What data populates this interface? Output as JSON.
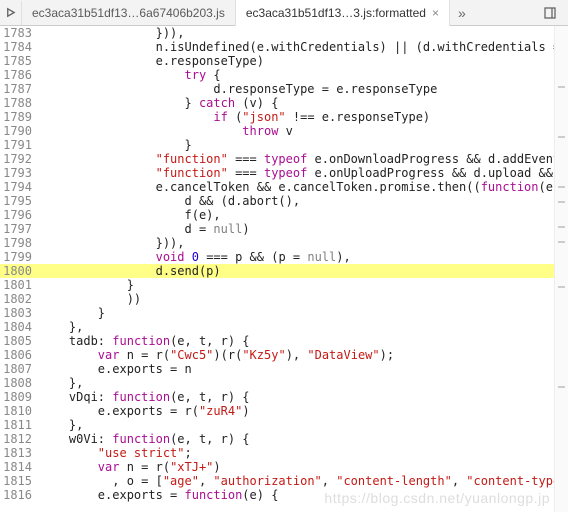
{
  "tabs": {
    "inactive_label": "ec3aca31b51df13…6a67406b203.js",
    "active_label": "ec3aca31b51df13…3.js:formatted",
    "close_glyph": "×",
    "more_glyph": "»"
  },
  "watermark": "https://blog.csdn.net/yuanlongp.jp",
  "gutter_ticks": [
    60,
    110,
    160,
    175,
    200,
    215,
    260,
    360
  ],
  "lines": [
    {
      "n": 1783,
      "indent": 16,
      "tokens": [
        "})),"
      ]
    },
    {
      "n": 1784,
      "indent": 16,
      "tokens": [
        "n.isUndefined(e.withCredentials) || (d.withCredentials = !!e"
      ]
    },
    {
      "n": 1785,
      "indent": 16,
      "tokens": [
        "e.responseType)"
      ]
    },
    {
      "n": 1786,
      "indent": 20,
      "tokens": [
        {
          "cls": "kw",
          "t": "try"
        },
        " {"
      ]
    },
    {
      "n": 1787,
      "indent": 24,
      "tokens": [
        "d.responseType = e.responseType"
      ]
    },
    {
      "n": 1788,
      "indent": 20,
      "tokens": [
        "} ",
        {
          "cls": "kw",
          "t": "catch"
        },
        " (v) {"
      ]
    },
    {
      "n": 1789,
      "indent": 24,
      "tokens": [
        {
          "cls": "kw",
          "t": "if"
        },
        " (",
        {
          "cls": "str",
          "t": "\"json\""
        },
        " !== e.responseType)"
      ]
    },
    {
      "n": 1790,
      "indent": 28,
      "tokens": [
        {
          "cls": "kw",
          "t": "throw"
        },
        " v"
      ]
    },
    {
      "n": 1791,
      "indent": 20,
      "tokens": [
        "}"
      ]
    },
    {
      "n": 1792,
      "indent": 16,
      "tokens": [
        {
          "cls": "str",
          "t": "\"function\""
        },
        " === ",
        {
          "cls": "kw",
          "t": "typeof"
        },
        " e.onDownloadProgress && d.addEventList"
      ]
    },
    {
      "n": 1793,
      "indent": 16,
      "tokens": [
        {
          "cls": "str",
          "t": "\"function\""
        },
        " === ",
        {
          "cls": "kw",
          "t": "typeof"
        },
        " e.onUploadProgress && d.upload && d.up"
      ]
    },
    {
      "n": 1794,
      "indent": 16,
      "tokens": [
        "e.cancelToken && e.cancelToken.promise.then((",
        {
          "cls": "kw",
          "t": "function"
        },
        "(e) {"
      ]
    },
    {
      "n": 1795,
      "indent": 20,
      "tokens": [
        "d && (d.abort(),"
      ]
    },
    {
      "n": 1796,
      "indent": 20,
      "tokens": [
        "f(e),"
      ]
    },
    {
      "n": 1797,
      "indent": 20,
      "tokens": [
        "d = ",
        {
          "cls": "null",
          "t": "null"
        },
        ")"
      ]
    },
    {
      "n": 1798,
      "indent": 16,
      "tokens": [
        "})),"
      ]
    },
    {
      "n": 1799,
      "indent": 16,
      "tokens": [
        {
          "cls": "kw",
          "t": "void"
        },
        " ",
        {
          "cls": "lit",
          "t": "0"
        },
        " === p && (p = ",
        {
          "cls": "null",
          "t": "null"
        },
        "),"
      ]
    },
    {
      "n": 1800,
      "indent": 16,
      "tokens": [
        "d.send(p)"
      ],
      "hl": true
    },
    {
      "n": 1801,
      "indent": 12,
      "tokens": [
        "}"
      ]
    },
    {
      "n": 1802,
      "indent": 12,
      "tokens": [
        "))"
      ]
    },
    {
      "n": 1803,
      "indent": 8,
      "tokens": [
        "}"
      ]
    },
    {
      "n": 1804,
      "indent": 4,
      "tokens": [
        "},"
      ]
    },
    {
      "n": 1805,
      "indent": 4,
      "tokens": [
        "tadb: ",
        {
          "cls": "kw",
          "t": "function"
        },
        "(e, t, r) {"
      ]
    },
    {
      "n": 1806,
      "indent": 8,
      "tokens": [
        {
          "cls": "kw",
          "t": "var"
        },
        " n = r(",
        {
          "cls": "str",
          "t": "\"Cwc5\""
        },
        ")(r(",
        {
          "cls": "str",
          "t": "\"Kz5y\""
        },
        "), ",
        {
          "cls": "str",
          "t": "\"DataView\""
        },
        ");"
      ]
    },
    {
      "n": 1807,
      "indent": 8,
      "tokens": [
        "e.exports = n"
      ]
    },
    {
      "n": 1808,
      "indent": 4,
      "tokens": [
        "},"
      ]
    },
    {
      "n": 1809,
      "indent": 4,
      "tokens": [
        "vDqi: ",
        {
          "cls": "kw",
          "t": "function"
        },
        "(e, t, r) {"
      ]
    },
    {
      "n": 1810,
      "indent": 8,
      "tokens": [
        "e.exports = r(",
        {
          "cls": "str",
          "t": "\"zuR4\""
        },
        ")"
      ]
    },
    {
      "n": 1811,
      "indent": 4,
      "tokens": [
        "},"
      ]
    },
    {
      "n": 1812,
      "indent": 4,
      "tokens": [
        "w0Vi: ",
        {
          "cls": "kw",
          "t": "function"
        },
        "(e, t, r) {"
      ]
    },
    {
      "n": 1813,
      "indent": 8,
      "tokens": [
        {
          "cls": "str",
          "t": "\"use strict\""
        },
        ";"
      ]
    },
    {
      "n": 1814,
      "indent": 8,
      "tokens": [
        {
          "cls": "kw",
          "t": "var"
        },
        " n = r(",
        {
          "cls": "str",
          "t": "\"xTJ+\""
        },
        ")"
      ]
    },
    {
      "n": 1815,
      "indent": 10,
      "tokens": [
        ", o = [",
        {
          "cls": "str",
          "t": "\"age\""
        },
        ", ",
        {
          "cls": "str",
          "t": "\"authorization\""
        },
        ", ",
        {
          "cls": "str",
          "t": "\"content-length\""
        },
        ", ",
        {
          "cls": "str",
          "t": "\"content-type\""
        },
        ", ",
        {
          "cls": "str",
          "t": "\""
        }
      ]
    },
    {
      "n": 1816,
      "indent": 8,
      "tokens": [
        "e.exports = ",
        {
          "cls": "kw",
          "t": "function"
        },
        "(e) {"
      ]
    }
  ]
}
